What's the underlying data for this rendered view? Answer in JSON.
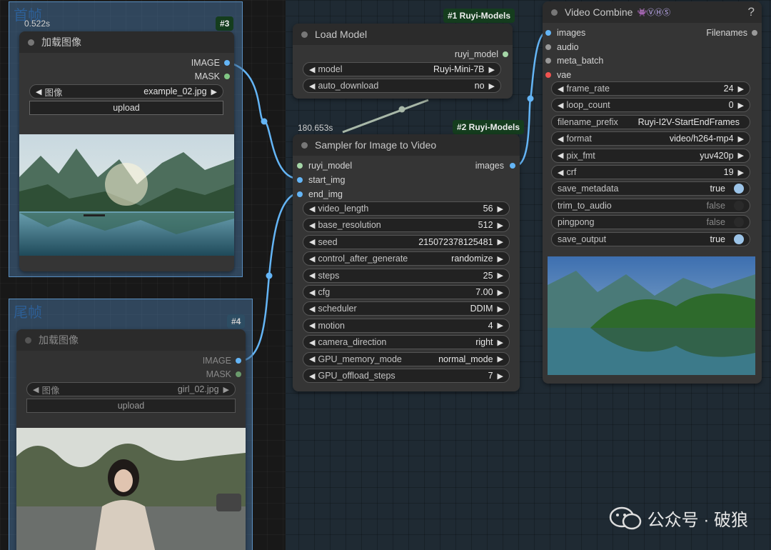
{
  "group_first": {
    "title": "首帧"
  },
  "group_last": {
    "title": "尾帧"
  },
  "load_image_1": {
    "timer": "0.522s",
    "id_badge": "#3",
    "title": "加载图像",
    "outputs": [
      "IMAGE",
      "MASK"
    ],
    "image_widget": {
      "label": "图像",
      "value": "example_02.jpg"
    },
    "upload_label": "upload"
  },
  "load_image_2": {
    "id_badge": "#4",
    "title": "加载图像",
    "outputs": [
      "IMAGE",
      "MASK"
    ],
    "image_widget": {
      "label": "图像",
      "value": "girl_02.jpg"
    },
    "upload_label": "upload"
  },
  "load_model": {
    "badge": "#1 Ruyi-Models",
    "title": "Load Model",
    "output": "ruyi_model",
    "widgets": [
      {
        "label": "model",
        "value": "Ruyi-Mini-7B"
      },
      {
        "label": "auto_download",
        "value": "no"
      }
    ]
  },
  "sampler": {
    "timer": "180.653s",
    "badge": "#2 Ruyi-Models",
    "title": "Sampler for Image to Video",
    "inputs": [
      "ruyi_model",
      "start_img",
      "end_img"
    ],
    "output": "images",
    "widgets": [
      {
        "label": "video_length",
        "value": "56"
      },
      {
        "label": "base_resolution",
        "value": "512"
      },
      {
        "label": "seed",
        "value": "215072378125481"
      },
      {
        "label": "control_after_generate",
        "value": "randomize"
      },
      {
        "label": "steps",
        "value": "25"
      },
      {
        "label": "cfg",
        "value": "7.00"
      },
      {
        "label": "scheduler",
        "value": "DDIM"
      },
      {
        "label": "motion",
        "value": "4"
      },
      {
        "label": "camera_direction",
        "value": "right"
      },
      {
        "label": "GPU_memory_mode",
        "value": "normal_mode"
      },
      {
        "label": "GPU_offload_steps",
        "value": "7"
      }
    ]
  },
  "video_combine": {
    "title": "Video Combine",
    "help": "?",
    "inputs": [
      "images",
      "audio",
      "meta_batch",
      "vae"
    ],
    "output": "Filenames",
    "widgets": [
      {
        "label": "frame_rate",
        "value": "24"
      },
      {
        "label": "loop_count",
        "value": "0"
      },
      {
        "label": "filename_prefix",
        "value": "Ruyi-I2V-StartEndFrames"
      },
      {
        "label": "format",
        "value": "video/h264-mp4"
      },
      {
        "label": "pix_fmt",
        "value": "yuv420p"
      },
      {
        "label": "crf",
        "value": "19"
      },
      {
        "label": "save_metadata",
        "value": "true"
      },
      {
        "label": "trim_to_audio",
        "value": "false"
      },
      {
        "label": "pingpong",
        "value": "false"
      },
      {
        "label": "save_output",
        "value": "true"
      }
    ]
  },
  "watermark": {
    "text": "公众号 · 破狼"
  },
  "colors": {
    "image_port": "#64b5f6",
    "mask_port": "#81c784",
    "model_port": "#a5d6a7",
    "link": "#64b5f6",
    "vae_port": "#ef5350"
  }
}
